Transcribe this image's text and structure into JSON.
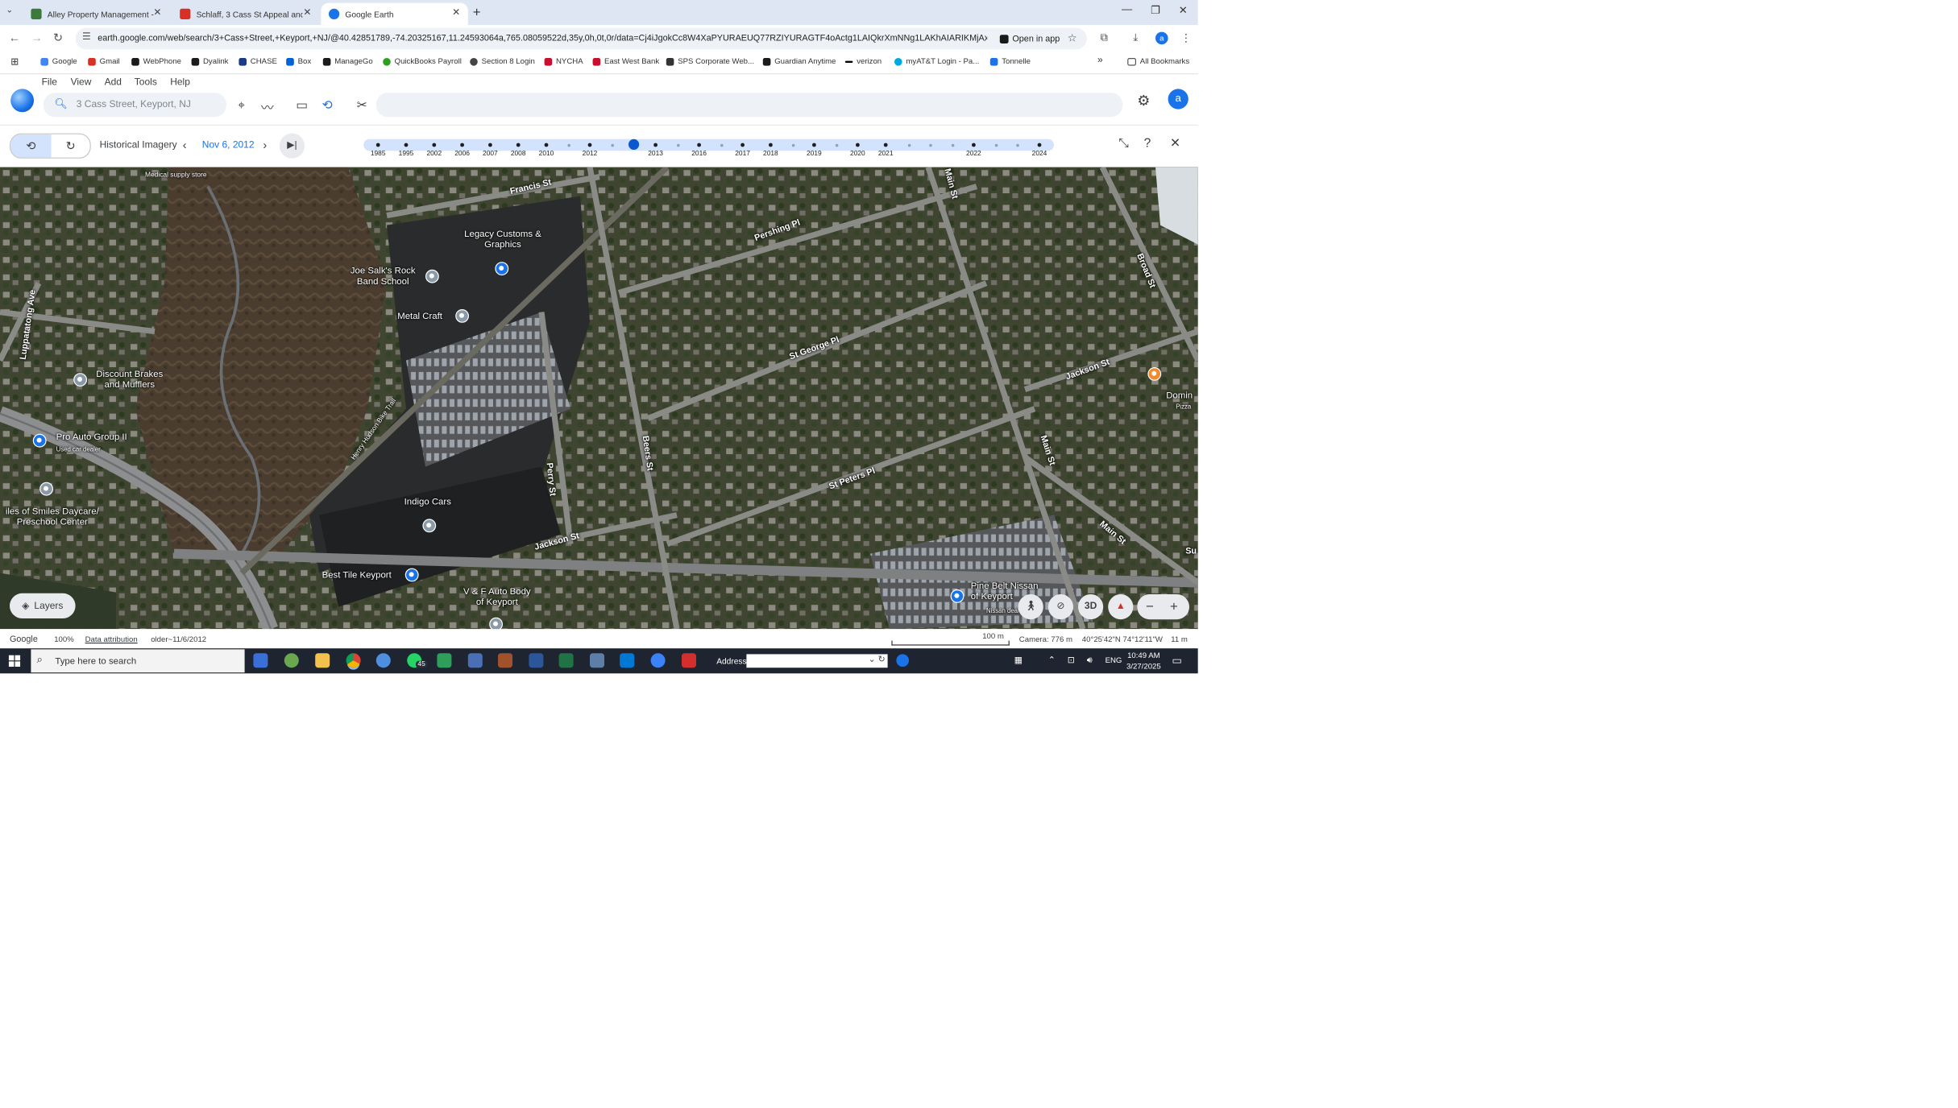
{
  "browser": {
    "tabs": [
      {
        "title": "Alley Property Management - C",
        "favicon_color": "#3b7a3b"
      },
      {
        "title": "Schlaff, 3 Cass St Appeal and In",
        "favicon_color": "#d93025"
      },
      {
        "title": "Google Earth",
        "favicon_color": "#1a73e8"
      }
    ],
    "new_tab": "+",
    "url": "earth.google.com/web/search/3+Cass+Street,+Keyport,+NJ/@40.42851789,-74.20325167,11.24593064a,765.08059522d,35y,0h,0t,0r/data=Cj4iJgokCc8W4XaPYURAEUQ77RZIYURAGTF4oActg1LAIQkrXmNNg1LAKhAIARIKMjAxMi0...",
    "open_in_app": "Open in app",
    "profile_initial": "a"
  },
  "bookmarks": [
    {
      "label": "Google",
      "color": "#4285f4"
    },
    {
      "label": "Gmail",
      "color": "#d93025"
    },
    {
      "label": "WebPhone",
      "color": "#1a1a1a"
    },
    {
      "label": "Dyalink",
      "color": "#1a1a1a"
    },
    {
      "label": "CHASE",
      "color": "#1a3a8a"
    },
    {
      "label": "Box",
      "color": "#0061d5"
    },
    {
      "label": "ManageGo",
      "color": "#1a1a1a"
    },
    {
      "label": "QuickBooks Payroll",
      "color": "#2ca01c"
    },
    {
      "label": "Section 8 Login",
      "color": "#444444"
    },
    {
      "label": "NYCHA",
      "color": "#c8102e"
    },
    {
      "label": "East West Bank",
      "color": "#c8102e"
    },
    {
      "label": "SPS Corporate Web...",
      "color": "#333333"
    },
    {
      "label": "Guardian Anytime",
      "color": "#1a1a1a"
    },
    {
      "label": "verizon",
      "color": "#000000"
    },
    {
      "label": "myAT&T Login - Pa...",
      "color": "#00a8e0"
    },
    {
      "label": "Tonnelle",
      "color": "#1a73e8"
    }
  ],
  "bookmarks_more": "»",
  "all_bookmarks": "All Bookmarks",
  "earth": {
    "menu": [
      "File",
      "View",
      "Add",
      "Tools",
      "Help"
    ],
    "search_placeholder": "3 Cass Street, Keyport, NJ",
    "user_initial": "a"
  },
  "historical": {
    "title": "Historical Imagery",
    "date": "Nov 6, 2012",
    "timeline_years": [
      "1985",
      "1995",
      "2002",
      "2006",
      "2007",
      "2008",
      "2010",
      "2012",
      "2013",
      "2016",
      "2017",
      "2018",
      "2019",
      "2020",
      "2021",
      "2022",
      "2024"
    ],
    "selected_year": "2012"
  },
  "map": {
    "places": [
      {
        "name": "Medical supply store"
      },
      {
        "name": "Legacy Customs & Graphics"
      },
      {
        "name": "Joe Salk's Rock Band School"
      },
      {
        "name": "Metal Craft"
      },
      {
        "name": "Discount Brakes and Mufflers"
      },
      {
        "name": "Pro Auto Group II",
        "sub": "Used car dealer"
      },
      {
        "name": "iles of Smiles Daycare/ Preschool Center"
      },
      {
        "name": "Indigo Cars"
      },
      {
        "name": "Best Tile Keyport"
      },
      {
        "name": "V & F Auto Body of Keyport"
      },
      {
        "name": "Pine Belt Nissan of Keyport",
        "sub": "Nissan dealer"
      },
      {
        "name": "Domin",
        "sub": "Pizza"
      }
    ],
    "streets": [
      "Francis St",
      "Pershing Pl",
      "Main St",
      "Broad St",
      "Luppatatong Ave",
      "St George Pl",
      "Jackson St",
      "Henry Hudson Bike Trail",
      "Beers St",
      "Perry St",
      "St Peters Pl",
      "Main St",
      "Main St",
      "Jackson St",
      "Su"
    ],
    "layers_label": "Layers",
    "btn_3d": "3D"
  },
  "status": {
    "brand": "Google",
    "zoom": "100%",
    "attribution": "Data attribution",
    "imagery_date": "older~11/6/2012",
    "scale": "100 m",
    "camera": "Camera: 776 m",
    "coords": "40°25'42\"N 74°12'11\"W",
    "elevation": "11 m"
  },
  "taskbar": {
    "search": "Type here to search",
    "whatsapp_badge": "45",
    "address_label": "Address",
    "lang": "ENG",
    "time": "10:49 AM",
    "date": "3/27/2025"
  }
}
